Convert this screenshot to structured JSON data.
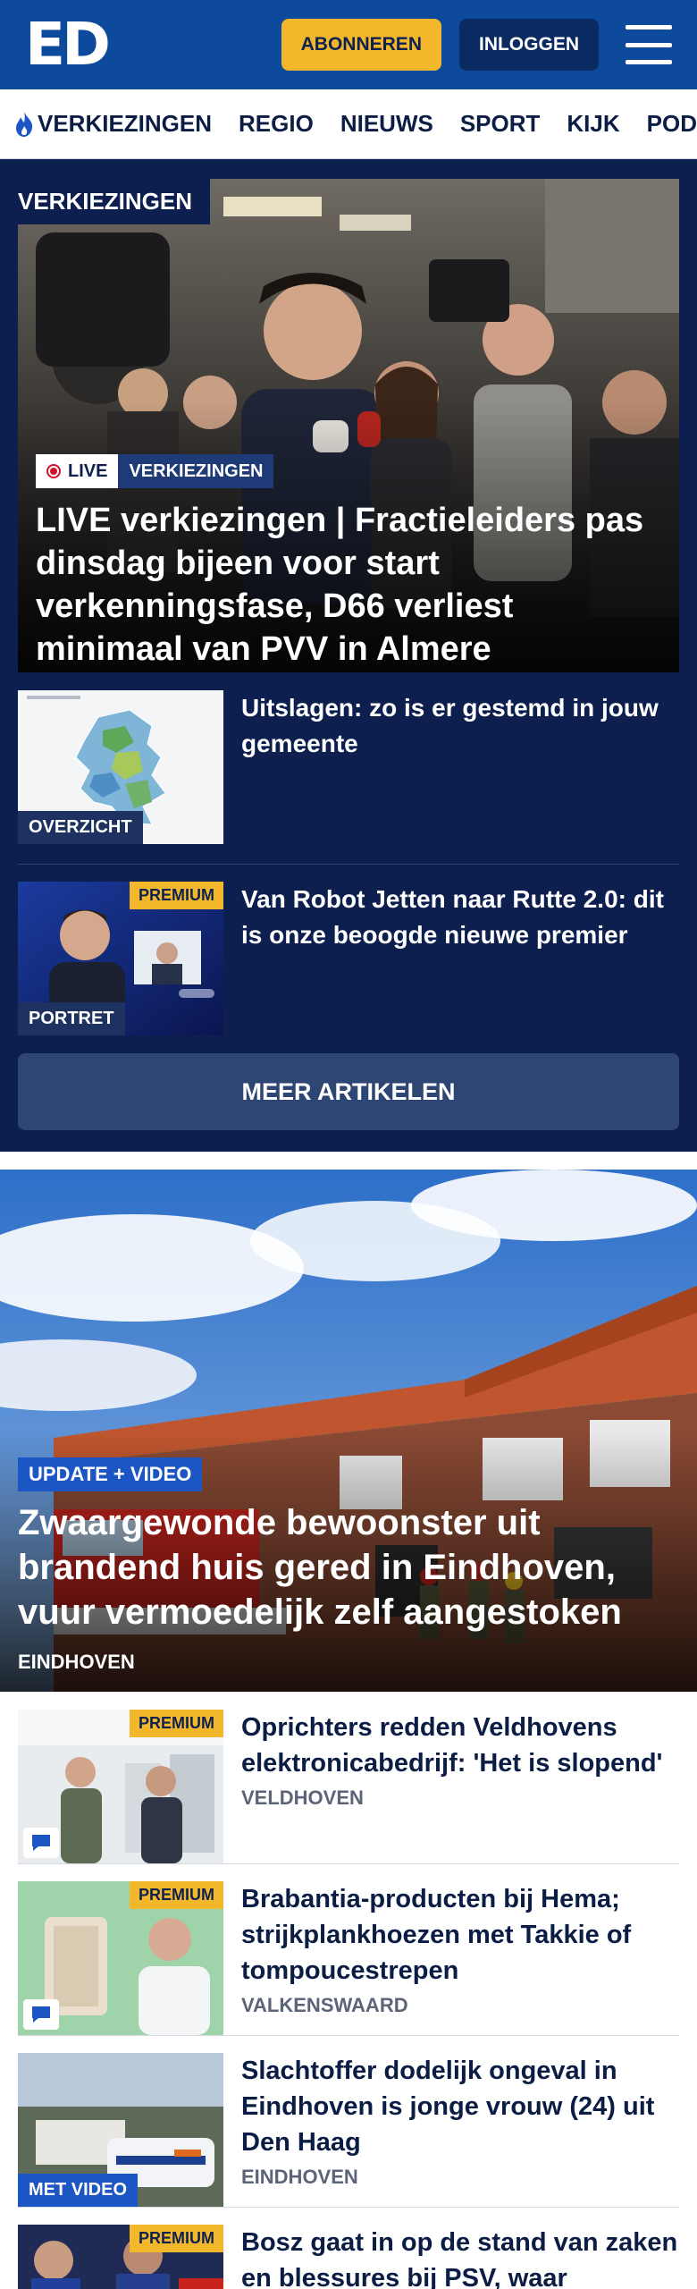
{
  "header": {
    "logo": "ED",
    "subscribe_label": "ABONNEREN",
    "login_label": "INLOGGEN"
  },
  "nav": {
    "items": [
      "VERKIEZINGEN",
      "REGIO",
      "NIEUWS",
      "SPORT",
      "KIJK",
      "PODC"
    ]
  },
  "elections": {
    "section_label": "VERKIEZINGEN",
    "hero": {
      "live_label": "LIVE",
      "category": "VERKIEZINGEN",
      "title": "LIVE verkiezingen | Fractieleiders pas dinsdag bijeen voor start verkenningsfase, D66 verliest minimaal van PVV in Almere"
    },
    "articles": [
      {
        "thumb_label": "OVERZICHT",
        "title": "Uitslagen: zo is er gestemd in jouw gemeente"
      },
      {
        "thumb_label": "PORTRET",
        "premium": "PREMIUM",
        "title": "Van Robot Jetten naar Rutte 2.0: dit is onze beoogde nieuwe premier"
      }
    ],
    "more_label": "MEER ARTIKELEN"
  },
  "main_hero": {
    "badge": "UPDATE + VIDEO",
    "title": "Zwaargewonde bewoonster uit brandend huis gered in Eindhoven, vuur vermoedelijk zelf aangestoken",
    "location": "EINDHOVEN"
  },
  "list": [
    {
      "premium": "PREMIUM",
      "title": "Oprichters redden Veldhovens elektronicabedrijf: 'Het is slopend'",
      "location": "VELDHOVEN"
    },
    {
      "premium": "PREMIUM",
      "title": "Brabantia-producten bij Hema; strijkplankhoezen met Takkie of tompoucestrepen",
      "location": "VALKENSWAARD"
    },
    {
      "video_label": "MET VIDEO",
      "title": "Slachtoffer dodelijk ongeval in Eindhoven is jonge vrouw (24) uit Den Haag",
      "location": "EINDHOVEN"
    },
    {
      "premium": "PREMIUM",
      "title": "Bosz gaat in op de stand van zaken en blessures bij PSV, waar"
    }
  ],
  "colors": {
    "header_blue": "#0d4a9b",
    "navy": "#0d1f4f",
    "accent_yellow": "#f3b72c",
    "badge_blue": "#1c56c4"
  }
}
